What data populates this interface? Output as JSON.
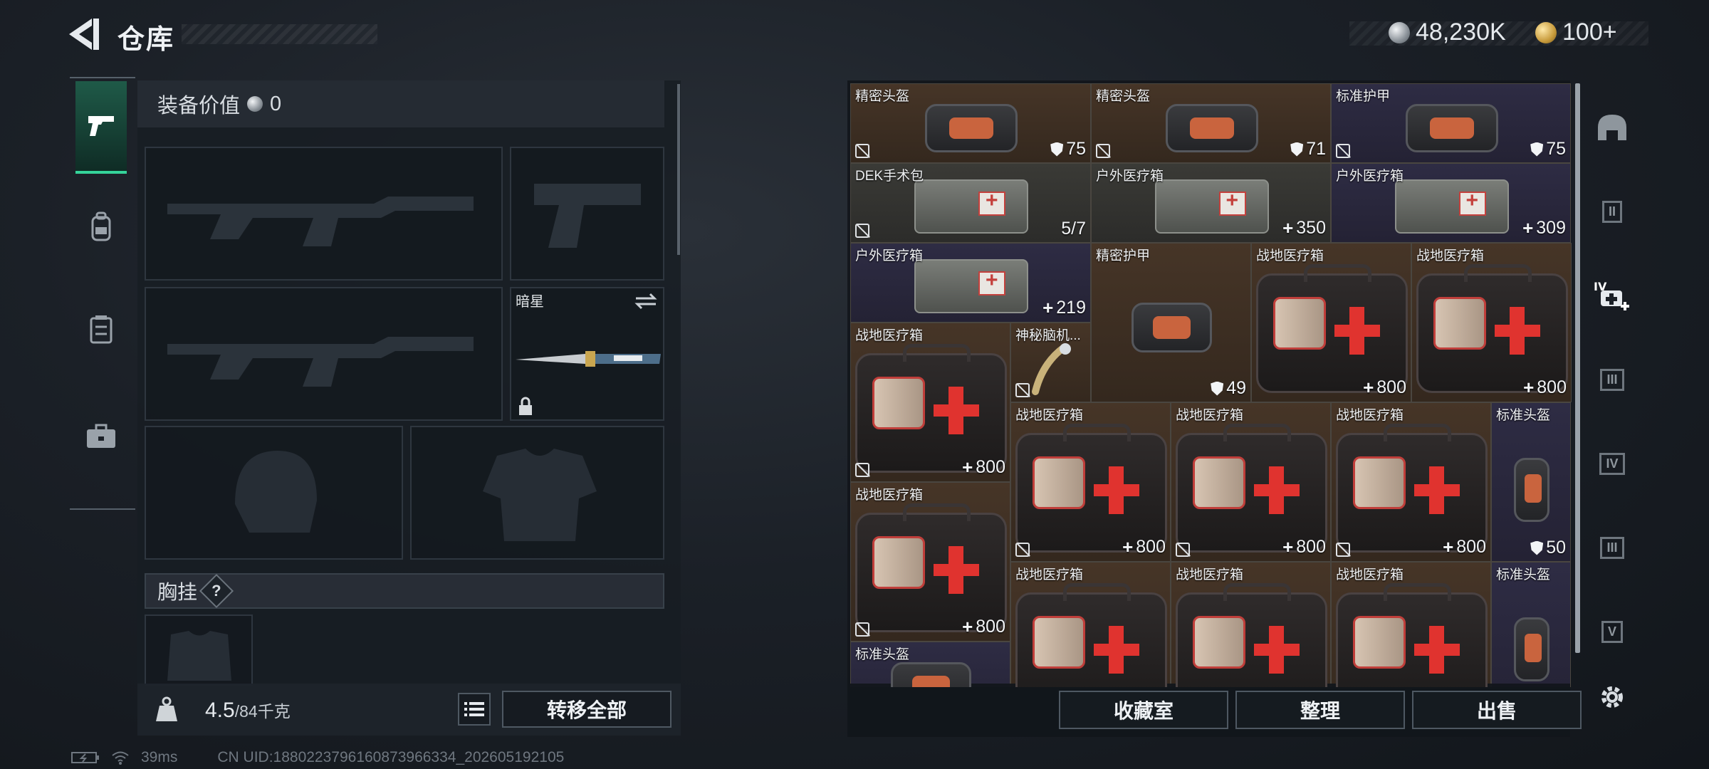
{
  "header": {
    "title": "仓库",
    "currency_silver": "48,230K",
    "currency_gold": "100+"
  },
  "status": {
    "ping": "39ms",
    "uid": "CN UID:1880223796160873966334_202605192105"
  },
  "tabs": [
    {
      "name": "weapons",
      "icon": "pistol-icon",
      "active": true
    },
    {
      "name": "backpack",
      "icon": "backpack-icon"
    },
    {
      "name": "vest",
      "icon": "chest-rig-icon"
    },
    {
      "name": "case",
      "icon": "briefcase-icon"
    }
  ],
  "loadout": {
    "value_label": "装备价值",
    "value": "0",
    "melee_name": "暗星",
    "chest_label": "胸挂",
    "chest_hint": "?",
    "weight_current": "4.5",
    "weight_max": "/84千克",
    "transfer_all": "转移全部"
  },
  "stash": {
    "items": [
      {
        "name": "精密头盔",
        "value": "75",
        "kind": "shield",
        "bg": "brown",
        "art": "bag"
      },
      {
        "name": "精密头盔",
        "value": "71",
        "kind": "shield",
        "bg": "brown",
        "art": "bag"
      },
      {
        "name": "标准护甲",
        "value": "75",
        "kind": "shield",
        "bg": "violet",
        "art": "bag"
      },
      {
        "name": "DEK手术包",
        "value": "5/7",
        "kind": "count",
        "bg": "gray",
        "art": "kit"
      },
      {
        "name": "户外医疗箱",
        "value": "350",
        "kind": "plus",
        "bg": "gray",
        "art": "kit"
      },
      {
        "name": "户外医疗箱",
        "value": "309",
        "kind": "plus",
        "bg": "violet",
        "art": "kit"
      },
      {
        "name": "户外医疗箱",
        "value": "219",
        "kind": "plus",
        "bg": "violet",
        "art": "kit"
      },
      {
        "name": "精密护甲",
        "value": "49",
        "kind": "shield",
        "bg": "brown",
        "art": "bag"
      },
      {
        "name": "战地医疗箱",
        "value": "800",
        "kind": "plus",
        "bg": "brown",
        "art": "med"
      },
      {
        "name": "战地医疗箱",
        "value": "800",
        "kind": "plus",
        "bg": "brown",
        "art": "med"
      },
      {
        "name": "战地医疗箱",
        "value": "800",
        "kind": "plus",
        "bg": "brown",
        "art": "med"
      },
      {
        "name": "神秘脑机...",
        "value": "",
        "kind": "none",
        "bg": "brown",
        "art": "none"
      },
      {
        "name": "战地医疗箱",
        "value": "800",
        "kind": "plus",
        "bg": "brown",
        "art": "med"
      },
      {
        "name": "战地医疗箱",
        "value": "800",
        "kind": "plus",
        "bg": "brown",
        "art": "med"
      },
      {
        "name": "战地医疗箱",
        "value": "800",
        "kind": "plus",
        "bg": "brown",
        "art": "med"
      },
      {
        "name": "标准头盔",
        "value": "50",
        "kind": "shield",
        "bg": "violet",
        "art": "small"
      },
      {
        "name": "战地医疗箱",
        "value": "800",
        "kind": "plus",
        "bg": "brown",
        "art": "med"
      },
      {
        "name": "战地医疗箱",
        "value": "",
        "kind": "none",
        "bg": "brown",
        "art": "med"
      },
      {
        "name": "战地医疗箱",
        "value": "",
        "kind": "none",
        "bg": "brown",
        "art": "med"
      },
      {
        "name": "战地医疗箱",
        "value": "",
        "kind": "none",
        "bg": "brown",
        "art": "med"
      },
      {
        "name": "标准头盔",
        "value": "",
        "kind": "none",
        "bg": "violet",
        "art": "small"
      },
      {
        "name": "标准头盔",
        "value": "",
        "kind": "none",
        "bg": "violet",
        "art": "bag"
      }
    ],
    "right_rail_labels": [
      "II",
      "IV",
      "III",
      "IV",
      "III",
      "V"
    ],
    "buttons": {
      "collection": "收藏室",
      "organize": "整理",
      "sell": "出售"
    }
  },
  "colors": {
    "accent": "#35d49a",
    "brown_cell": "#463527",
    "violet_cell": "#2e2c44",
    "med_red": "#e0332f"
  }
}
